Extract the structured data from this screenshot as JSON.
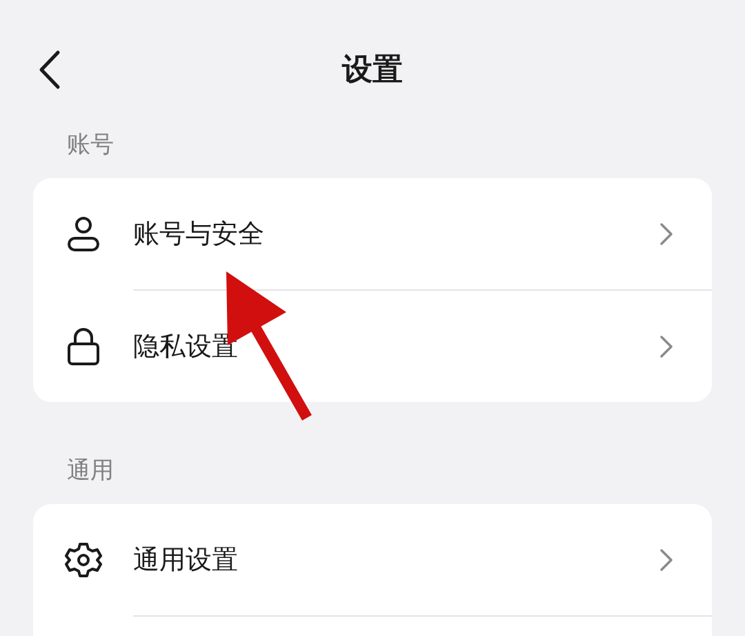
{
  "header": {
    "title": "设置"
  },
  "sections": [
    {
      "label": "账号",
      "items": [
        {
          "label": "账号与安全",
          "kind": "user"
        },
        {
          "label": "隐私设置",
          "kind": "lock"
        }
      ]
    },
    {
      "label": "通用",
      "items": [
        {
          "label": "通用设置",
          "kind": "gear"
        }
      ],
      "continues": true
    }
  ]
}
